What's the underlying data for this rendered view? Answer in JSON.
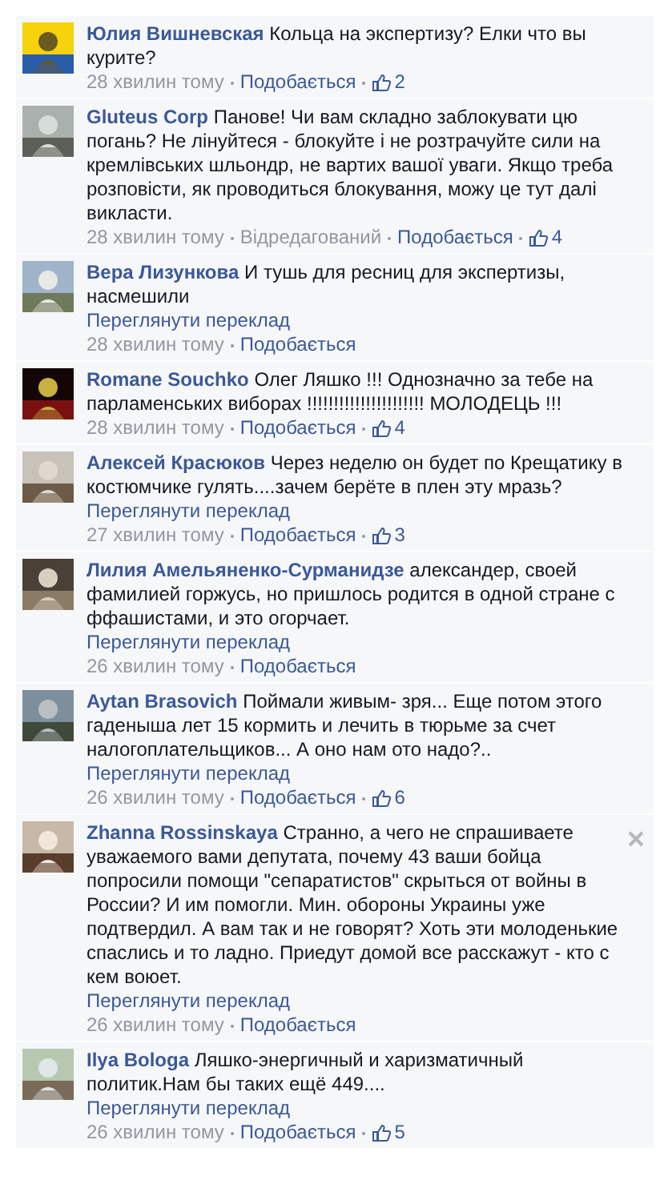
{
  "comments": [
    {
      "author": "Юлия Вишневская",
      "text": "Кольца на экспертизу? Елки что вы курите?",
      "time": "28 хвилин тому",
      "like": "Подобається",
      "likes": "2",
      "close_visible": false
    },
    {
      "author": "Gluteus Corp",
      "text": "Панове! Чи вам складно заблокувати цю погань? Не лінуйтеся - блокуйте і не розтрачуйте сили на кремлівських шльондр, не вартих вашої уваги. Якщо треба розповісти, як проводиться блокування, можу це тут далі викласти.",
      "time": "28 хвилин тому",
      "edited": "Відредагований",
      "like": "Подобається",
      "likes": "4",
      "close_visible": false
    },
    {
      "author": "Вера Лизункова",
      "text": "И тушь для ресниц для экспертизы, насмешили",
      "translate": "Переглянути переклад",
      "time": "28 хвилин тому",
      "like": "Подобається",
      "close_visible": false
    },
    {
      "author": "Romane Souchko",
      "text": "Олег Ляшко !!! Однозначно за тебе на парламенських виборах !!!!!!!!!!!!!!!!!!!!!! МОЛОДЕЦЬ !!!",
      "time": "28 хвилин тому",
      "like": "Подобається",
      "likes": "4",
      "close_visible": false
    },
    {
      "author": "Алексей Красюков",
      "text": "Через неделю он будет по Крещатику в костюмчике гулять....зачем берёте в плен эту мразь?",
      "translate": "Переглянути переклад",
      "time": "27 хвилин тому",
      "like": "Подобається",
      "likes": "3",
      "close_visible": false
    },
    {
      "author": "Лилия Амельяненко-Сурманидзе",
      "text": "александер, своей фамилией горжусь, но пришлось родится в одной стране с ффашистами, и это огорчает.",
      "translate": "Переглянути переклад",
      "time": "26 хвилин тому",
      "like": "Подобається",
      "close_visible": false
    },
    {
      "author": "Aytan Brasovich",
      "text": "Поймали живым- зря... Еще потом этого гаденыша лет 15 кормить и лечить в тюрьме за счет налогоплательщиков... А оно нам ото надо?..",
      "translate": "Переглянути переклад",
      "time": "26 хвилин тому",
      "like": "Подобається",
      "likes": "6",
      "close_visible": false
    },
    {
      "author": "Zhanna Rossinskaya",
      "text": "Странно, а чего не спрашиваете уважаемого вами депутата, почему 43 ваши бойца попросили помощи \"сепаратистов\" скрыться от войны в России? И им помогли. Мин. обороны Украины уже подтвердил. А вам так и не говорят? Хоть эти молоденькие спаслись и то ладно. Приедут домой все расскажут - кто с кем воюет.",
      "translate": "Переглянути переклад",
      "time": "26 хвилин тому",
      "like": "Подобається",
      "close_visible": true
    },
    {
      "author": "Ilya Bologa",
      "text": "Ляшко-энергичный и харизматичный политик.Нам бы таких ещё 449....",
      "translate": "Переглянути переклад",
      "time": "26 хвилин тому",
      "like": "Подобається",
      "likes": "5",
      "close_visible": false
    }
  ]
}
